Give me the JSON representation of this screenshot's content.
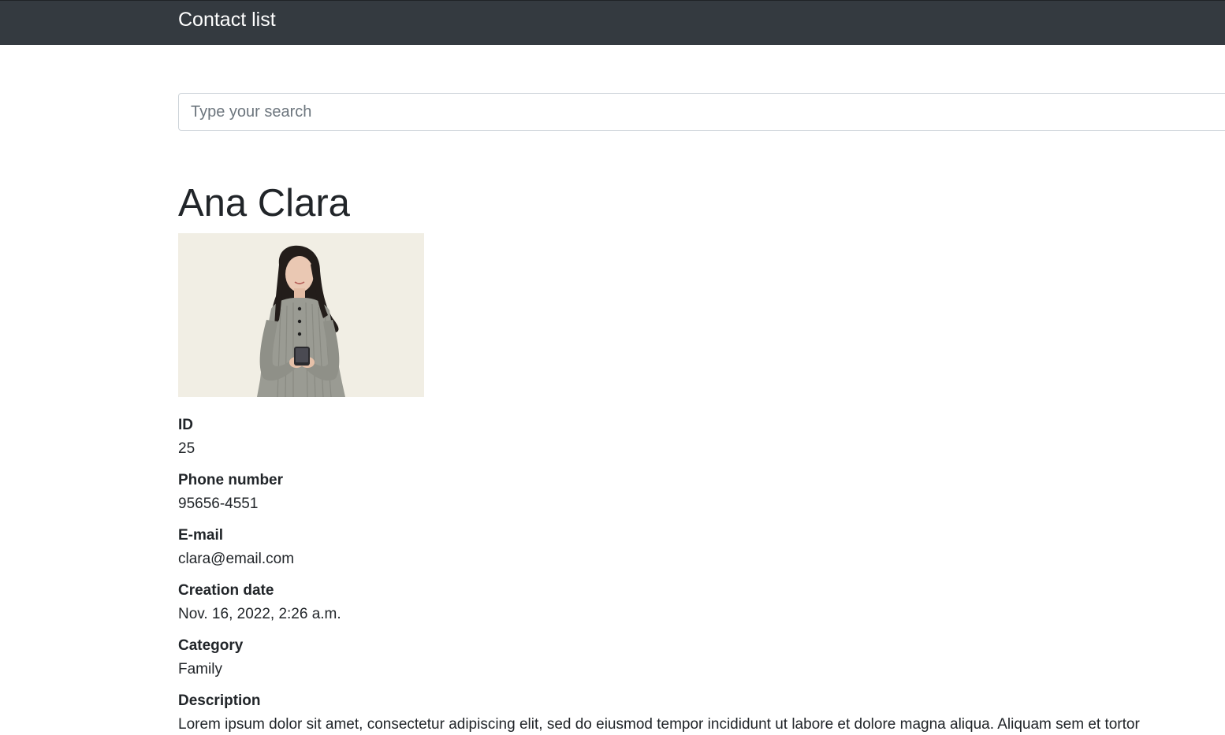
{
  "navbar": {
    "brand": "Contact list"
  },
  "search": {
    "placeholder": "Type your search",
    "value": ""
  },
  "contact": {
    "name": "Ana Clara",
    "fields": {
      "id": {
        "label": "ID",
        "value": "25"
      },
      "phone": {
        "label": "Phone number",
        "value": "95656-4551"
      },
      "email": {
        "label": "E-mail",
        "value": "clara@email.com"
      },
      "created": {
        "label": "Creation date",
        "value": "Nov. 16, 2022, 2:26 a.m."
      },
      "category": {
        "label": "Category",
        "value": "Family"
      },
      "description": {
        "label": "Description",
        "value": "Lorem ipsum dolor sit amet, consectetur adipiscing elit, sed do eiusmod tempor incididunt ut labore et dolore magna aliqua. Aliquam sem et tortor"
      }
    }
  },
  "colors": {
    "navbar_bg": "#343a40",
    "photo_bg": "#f1eee4",
    "text": "#212529"
  }
}
